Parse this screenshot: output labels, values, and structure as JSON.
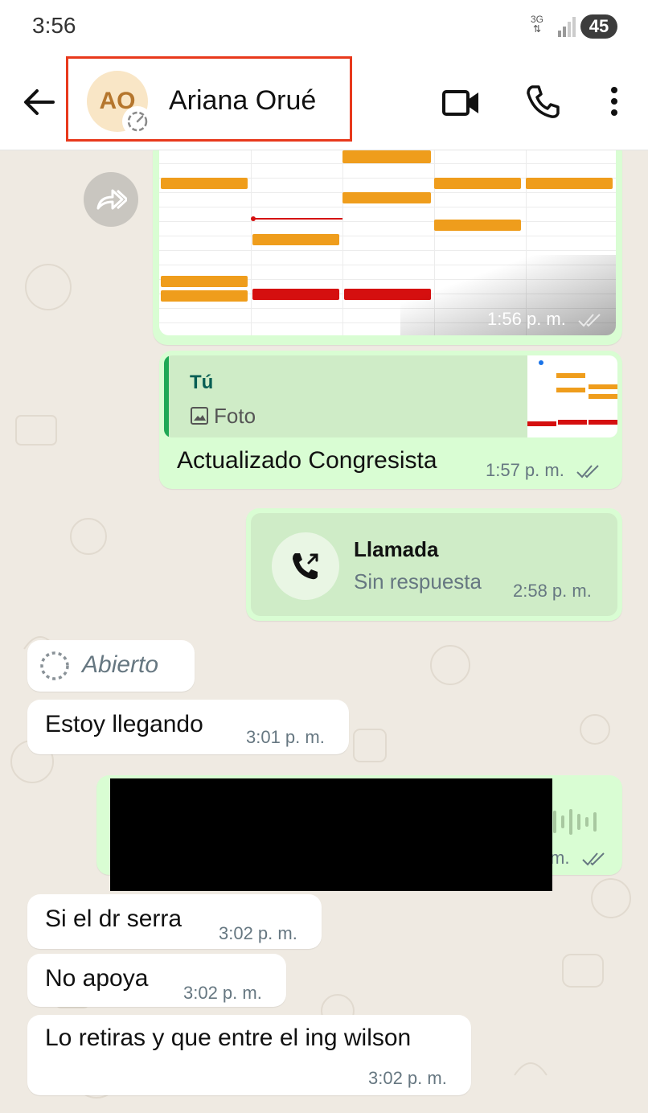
{
  "status_bar": {
    "time": "3:56",
    "network": "3G",
    "battery": "45"
  },
  "header": {
    "avatar_initials": "AO",
    "contact_name": "Ariana Orué"
  },
  "messages": {
    "image_msg": {
      "time": "1:56 p. m."
    },
    "reply_msg": {
      "quote_author": "Tú",
      "quote_type": "Foto",
      "text": "Actualizado Congresista",
      "time": "1:57 p. m."
    },
    "call_msg": {
      "title": "Llamada",
      "status": "Sin respuesta",
      "time": "2:58 p. m."
    },
    "opened_label": "Abierto",
    "in1": {
      "text": "Estoy llegando",
      "time": "3:01 p. m."
    },
    "audio_msg": {
      "time_fragment": "m."
    },
    "in2": {
      "text": "Si el dr serra",
      "time": "3:02 p. m."
    },
    "in3": {
      "text": "No apoya",
      "time": "3:02 p. m."
    },
    "in4": {
      "text": "Lo retiras y que entre el ing wilson",
      "time": "3:02 p. m."
    }
  },
  "colors": {
    "outgoing": "#d9fdd3",
    "incoming": "#ffffff",
    "chat_bg": "#efeae2",
    "highlight": "#e8391c",
    "accent": "#1fa855"
  },
  "icons": [
    "back-arrow-icon",
    "status-ring-icon",
    "video-call-icon",
    "phone-icon",
    "more-vert-icon",
    "forward-icon",
    "image-icon",
    "missed-call-icon",
    "double-check-icon",
    "view-once-icon",
    "waveform-icon"
  ]
}
